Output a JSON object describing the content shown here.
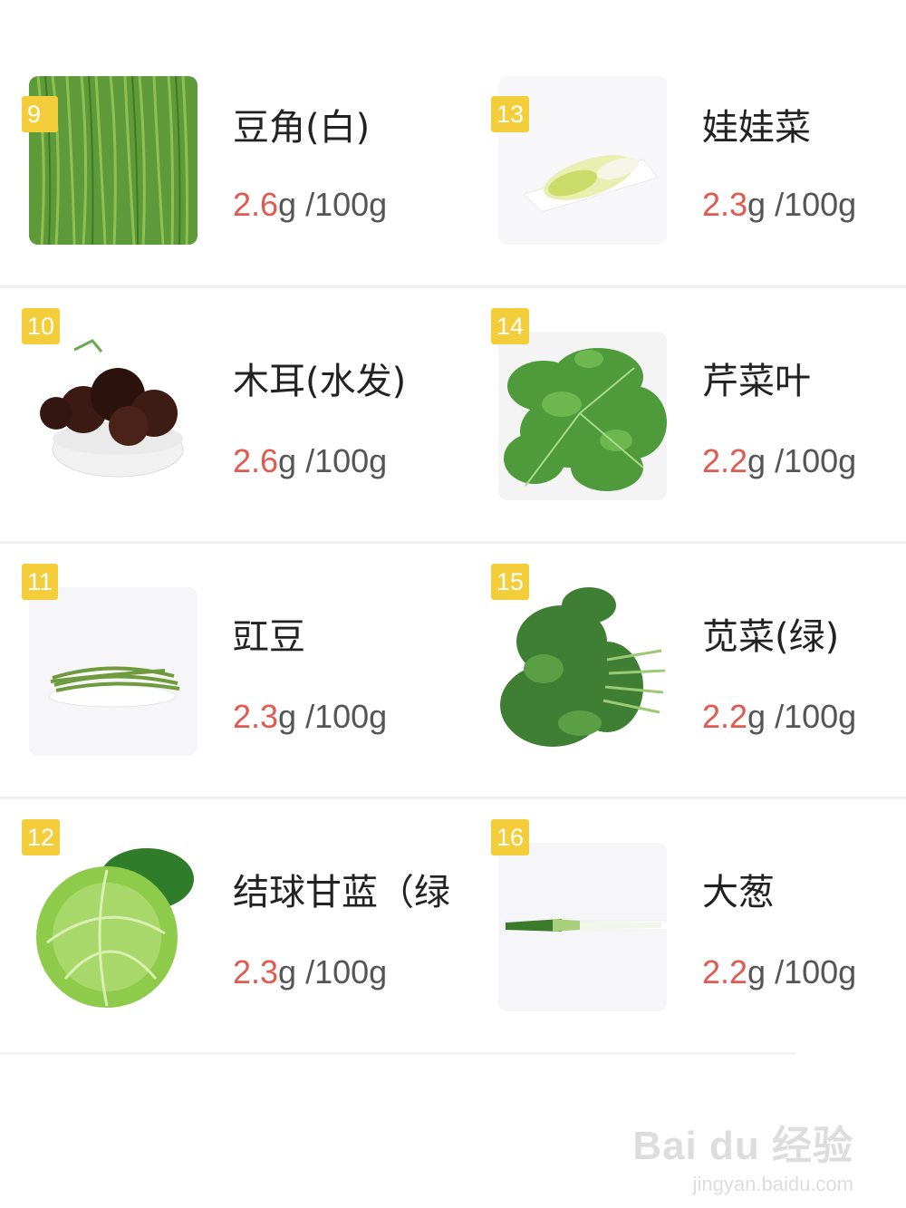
{
  "items": [
    {
      "badge": "9",
      "name": "豆角(白)",
      "num": "2.6",
      "unit": "g",
      "per": " /100g",
      "image": "green-beans"
    },
    {
      "badge": "13",
      "name": "娃娃菜",
      "num": "2.3",
      "unit": "g",
      "per": " /100g",
      "image": "baby-cabbage"
    },
    {
      "badge": "10",
      "name": "木耳(水发)",
      "num": "2.6",
      "unit": "g",
      "per": " /100g",
      "image": "wood-ear-bowl"
    },
    {
      "badge": "14",
      "name": "芹菜叶",
      "num": "2.2",
      "unit": "g",
      "per": " /100g",
      "image": "celery-leaves"
    },
    {
      "badge": "11",
      "name": "豇豆",
      "num": "2.3",
      "unit": "g",
      "per": " /100g",
      "image": "cowpea-plate"
    },
    {
      "badge": "15",
      "name": "苋菜(绿)",
      "num": "2.2",
      "unit": "g",
      "per": " /100g",
      "image": "amaranth"
    },
    {
      "badge": "12",
      "name": "结球甘蓝（绿",
      "num": "2.3",
      "unit": "g",
      "per": " /100g",
      "image": "cabbage"
    },
    {
      "badge": "16",
      "name": "大葱",
      "num": "2.2",
      "unit": "g",
      "per": " /100g",
      "image": "scallion"
    }
  ],
  "watermark": {
    "logo": "Bai du 经验",
    "url": "jingyan.baidu.com"
  },
  "colors": {
    "badge": "#f3cd3a",
    "value": "#e05a4f",
    "text": "#222222"
  }
}
